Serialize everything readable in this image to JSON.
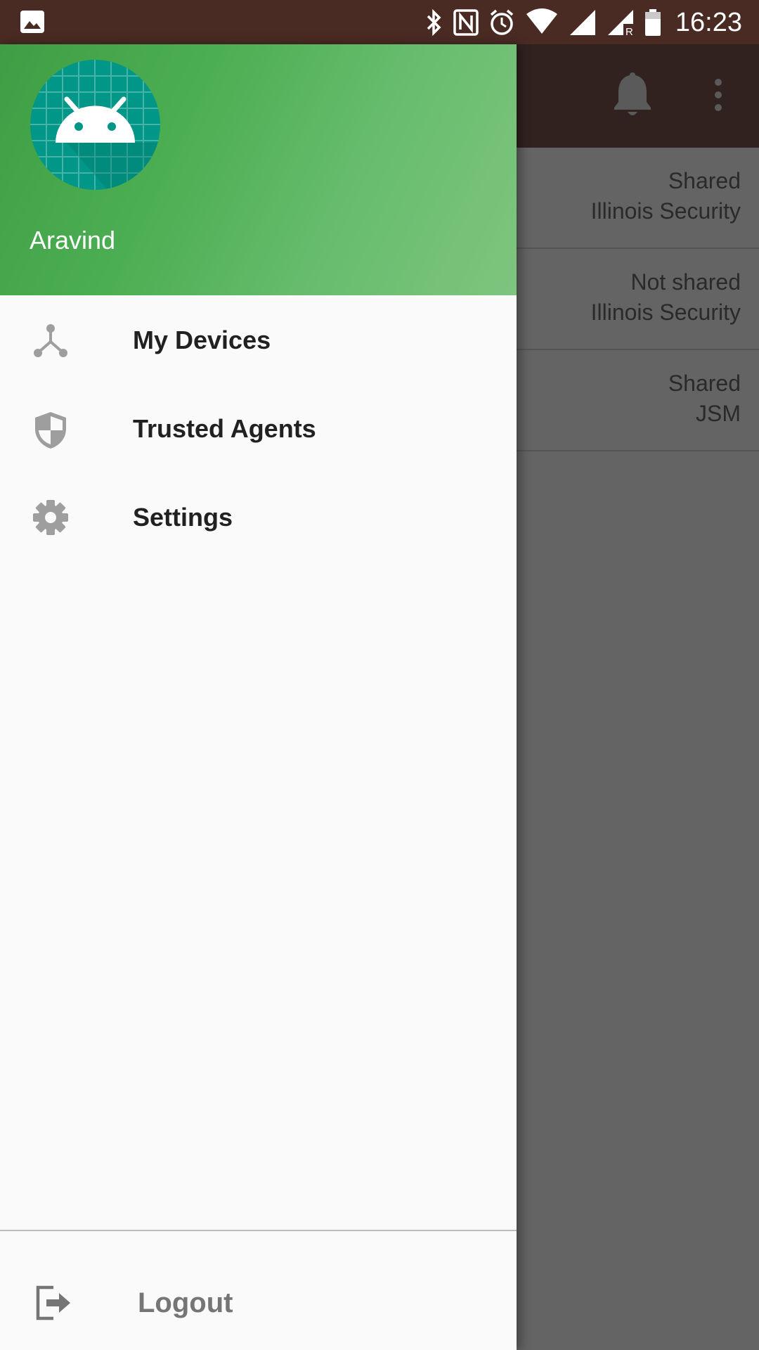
{
  "status_bar": {
    "time": "16:23",
    "icons": [
      "image-notification-icon",
      "bluetooth-icon",
      "nfc-icon",
      "alarm-icon",
      "wifi-icon",
      "signal-icon",
      "signal-roaming-icon",
      "battery-icon"
    ]
  },
  "drawer": {
    "header": {
      "user_name": "Aravind",
      "avatar_icon": "android-robot-icon",
      "avatar_color": "#009688"
    },
    "items": [
      {
        "label": "My Devices",
        "icon": "device-tree-icon"
      },
      {
        "label": "Trusted Agents",
        "icon": "shield-icon"
      },
      {
        "label": "Settings",
        "icon": "gear-icon"
      }
    ],
    "logout": {
      "label": "Logout",
      "icon": "logout-icon"
    }
  },
  "background": {
    "toolbar_icons": [
      "bell-icon",
      "more-vert-icon"
    ],
    "rows": [
      {
        "status": "Shared",
        "agent": "Illinois Security"
      },
      {
        "status": "Not shared",
        "agent": "Illinois Security"
      },
      {
        "status": "Shared",
        "agent": "JSM"
      }
    ]
  },
  "colors": {
    "status_bar": "#4a2b24",
    "header_green": "#4caf50",
    "scrim": "#646464"
  }
}
